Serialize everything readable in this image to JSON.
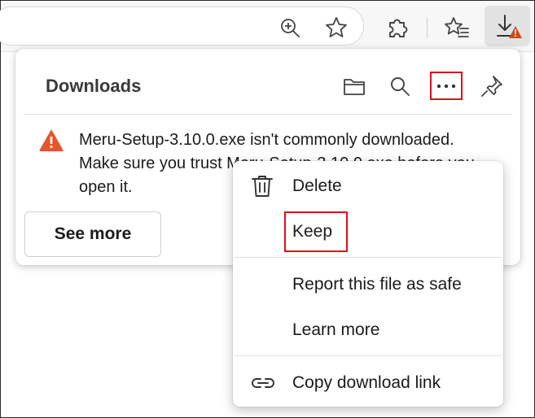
{
  "colors": {
    "accent_red": "#d8121b",
    "warning_orange": "#e8542b",
    "warning_badge": "#c0501f"
  },
  "toolbar": {
    "icons": [
      "zoom-in-icon",
      "favorite-star-icon",
      "extensions-puzzle-icon",
      "favorites-list-icon",
      "download-icon"
    ]
  },
  "downloads_panel": {
    "title": "Downloads",
    "header_icons": [
      "folder-icon",
      "search-icon",
      "more-options-icon",
      "pin-icon"
    ],
    "warning_line1": "Meru-Setup-3.10.0.exe isn't commonly downloaded.",
    "warning_line2": "Make sure you trust Meru-Setup-3.10.0.exe before you",
    "warning_line3": "open it.",
    "see_more_label": "See more"
  },
  "context_menu": {
    "items": [
      {
        "label": "Delete",
        "icon": "trash-icon"
      },
      {
        "label": "Keep",
        "icon": ""
      },
      {
        "label": "Report this file as safe",
        "icon": ""
      },
      {
        "label": "Learn more",
        "icon": ""
      },
      {
        "label": "Copy download link",
        "icon": "link-icon"
      }
    ]
  }
}
